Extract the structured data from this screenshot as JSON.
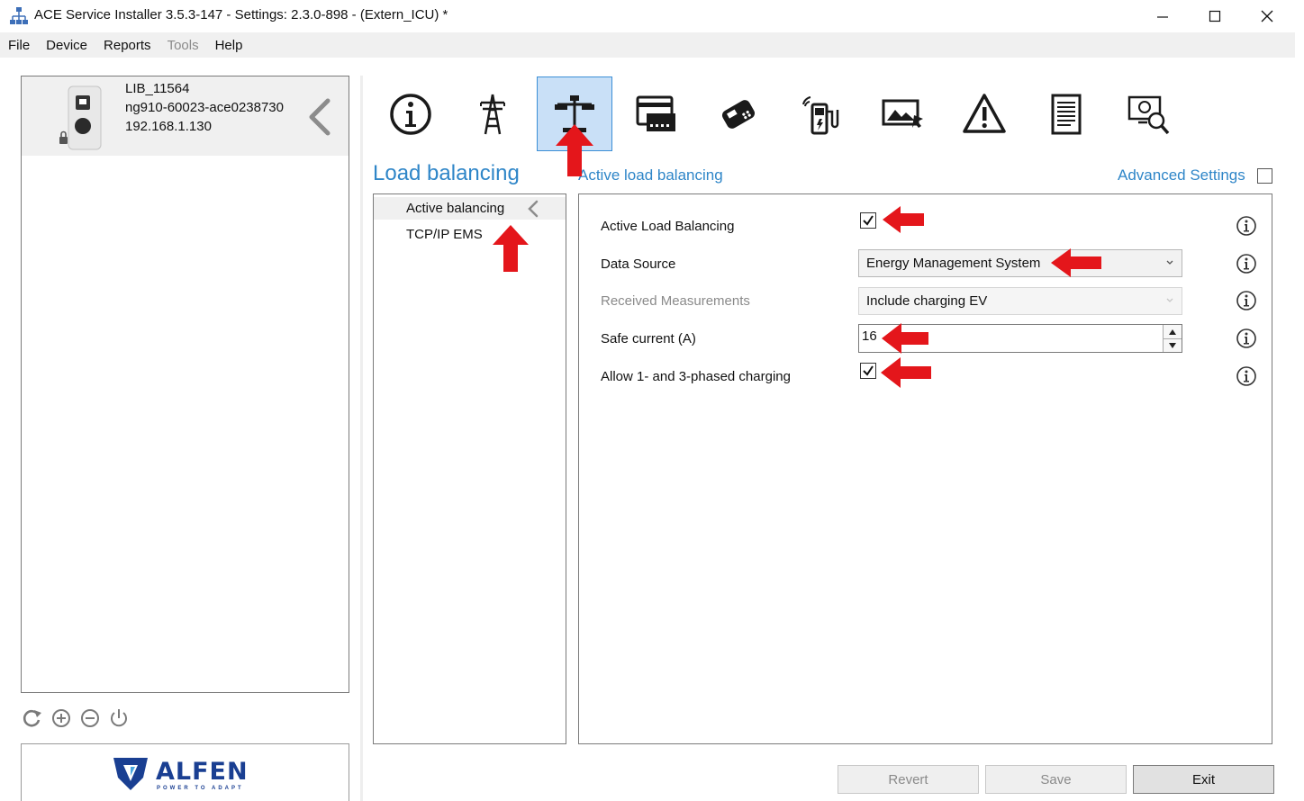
{
  "window": {
    "title": "ACE Service Installer 3.5.3-147 - Settings: 2.3.0-898 -  (Extern_ICU) *"
  },
  "menu": [
    {
      "label": "File",
      "enabled": true
    },
    {
      "label": "Device",
      "enabled": true
    },
    {
      "label": "Reports",
      "enabled": true
    },
    {
      "label": "Tools",
      "enabled": false
    },
    {
      "label": "Help",
      "enabled": true
    }
  ],
  "device": {
    "name": "LIB_11564",
    "id": "ng910-60023-ace0238730",
    "ip": "192.168.1.130"
  },
  "logo": {
    "word": "ALFEN",
    "tagline": "POWER TO ADAPT"
  },
  "toolbar": {
    "icons": [
      "info-icon",
      "power-tower-icon",
      "load-balance-icon",
      "card-reader-icon",
      "payment-terminal-icon",
      "charger-connectivity-icon",
      "display-image-icon",
      "warning-icon",
      "log-document-icon",
      "diagnostics-icon"
    ],
    "active_index": 2
  },
  "section": {
    "title": "Load balancing",
    "subtitle": "Active load balancing",
    "advanced_label": "Advanced Settings",
    "advanced_checked": false
  },
  "nav": {
    "items": [
      {
        "label": "Active balancing",
        "selected": true
      },
      {
        "label": "TCP/IP EMS",
        "selected": false
      }
    ]
  },
  "form": {
    "active_lb_label": "Active Load Balancing",
    "active_lb_checked": true,
    "data_source_label": "Data Source",
    "data_source_value": "Energy Management System",
    "received_label": "Received Measurements",
    "received_value": "Include charging EV",
    "safe_current_label": "Safe current (A)",
    "safe_current_value": "16",
    "phased_label": "Allow 1- and 3-phased charging",
    "phased_checked": true
  },
  "buttons": {
    "revert": "Revert",
    "save": "Save",
    "exit": "Exit"
  },
  "colors": {
    "accent": "#2f86c8",
    "annotation_arrow": "#e4161b",
    "active_tab_bg": "#c9e0f7",
    "logo_blue": "#1a3f92"
  }
}
